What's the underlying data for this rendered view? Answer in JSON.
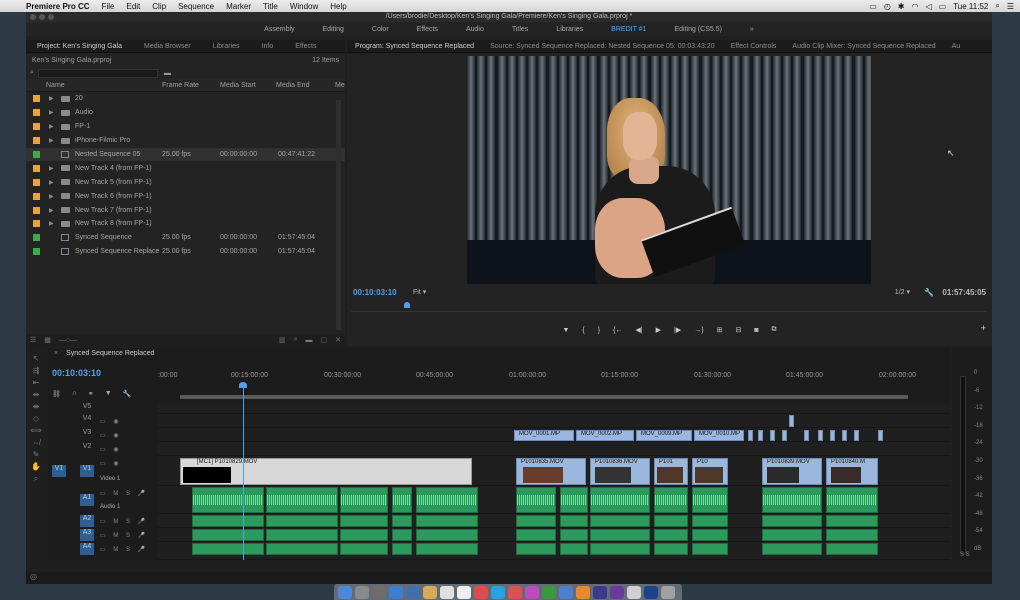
{
  "menubar": {
    "app": "Premiere Pro CC",
    "items": [
      "File",
      "Edit",
      "Clip",
      "Sequence",
      "Marker",
      "Title",
      "Window",
      "Help"
    ],
    "clock": "Tue 11:52"
  },
  "window": {
    "title": "/Users/brodie/Desktop/Ken's Singing Gala/Premiere/Ken's Singing Gala.prproj *"
  },
  "workspaces": {
    "tabs": [
      "Assembly",
      "Editing",
      "Color",
      "Effects",
      "Audio",
      "Titles",
      "Libraries"
    ],
    "active": "BREDIT #1",
    "extra": "Editing (CS5.5)"
  },
  "project": {
    "tabs": [
      "Project: Ken's Singing Gala",
      "Media Browser",
      "Libraries",
      "Info",
      "Effects"
    ],
    "file": "Ken's Singing Gala.prproj",
    "count": "12 Items",
    "headers": {
      "name": "Name",
      "frame_rate": "Frame Rate",
      "media_start": "Media Start",
      "media_end": "Media End",
      "more": "Me"
    },
    "rows": [
      {
        "name": "20",
        "color": "#e8a33d",
        "type": "folder",
        "fr": "",
        "ms": "",
        "me": ""
      },
      {
        "name": "Audio",
        "color": "#e8a33d",
        "type": "folder",
        "fr": "",
        "ms": "",
        "me": ""
      },
      {
        "name": "FP-1",
        "color": "#e8a33d",
        "type": "folder",
        "fr": "",
        "ms": "",
        "me": ""
      },
      {
        "name": "iPhone-Filmic Pro",
        "color": "#e8a33d",
        "type": "folder",
        "fr": "",
        "ms": "",
        "me": ""
      },
      {
        "name": "Nested Sequence 05",
        "color": "#3ea84a",
        "type": "seq",
        "fr": "25.00 fps",
        "ms": "00:00:00:00",
        "me": "00:47:41:22"
      },
      {
        "name": "New Track 4 (from FP-1)",
        "color": "#e8a33d",
        "type": "folder",
        "fr": "",
        "ms": "",
        "me": ""
      },
      {
        "name": "New Track 5 (from FP-1)",
        "color": "#e8a33d",
        "type": "folder",
        "fr": "",
        "ms": "",
        "me": ""
      },
      {
        "name": "New Track 6 (from FP-1)",
        "color": "#e8a33d",
        "type": "folder",
        "fr": "",
        "ms": "",
        "me": ""
      },
      {
        "name": "New Track 7 (from FP-1)",
        "color": "#e8a33d",
        "type": "folder",
        "fr": "",
        "ms": "",
        "me": ""
      },
      {
        "name": "New Track 8 (from FP-1)",
        "color": "#e8a33d",
        "type": "folder",
        "fr": "",
        "ms": "",
        "me": ""
      },
      {
        "name": "Synced Sequence",
        "color": "#3ea84a",
        "type": "seq",
        "fr": "25.00 fps",
        "ms": "00:00:00:00",
        "me": "01:57:45:04"
      },
      {
        "name": "Synced Sequence Replace",
        "color": "#3ea84a",
        "type": "seq",
        "fr": "25.00 fps",
        "ms": "00:00:00:00",
        "me": "01:57:45:04"
      }
    ]
  },
  "program": {
    "tabs": [
      "Program: Synced Sequence Replaced",
      "Source: Synced Sequence Replaced: Nested Sequence 05: 00:03:43:20",
      "Effect Controls",
      "Audio Clip Mixer: Synced Sequence Replaced",
      "Au"
    ],
    "timecode": "00:10:03:10",
    "fit": "Fit",
    "resolution": "1/2",
    "duration": "01:57:45:05"
  },
  "timeline": {
    "tab": "Synced Sequence Replaced",
    "timecode": "00:10:03:10",
    "ruler": [
      ":00:00",
      "00:15:00:00",
      "00:30:00:00",
      "00:45:00:00",
      "01:00:00:00",
      "01:15:00:00",
      "01:30:00:00",
      "01:45:00:00",
      "02:00:00:00"
    ],
    "tracks": [
      "V5",
      "V4",
      "V3",
      "V2",
      "V1",
      "A1",
      "A2",
      "A3",
      "A4"
    ],
    "v1_name": "Video 1",
    "a1_name": "Audio 1",
    "v1_src": "V1",
    "a1_src": "A1",
    "clips_v3": [
      "MOV_0001.MP",
      "MOV_0002.MP",
      "MOV_0009.MP",
      "MOV_0010.MP"
    ],
    "clips_v1": [
      "[MC1] P1010829.MOV",
      "P1010835.MOV",
      "P1010836.MOV",
      "P101",
      "P10",
      "P1010839.MOV",
      "P1010840.M"
    ]
  },
  "meter": {
    "scale": [
      "0",
      "-6",
      "-12",
      "-18",
      "-24",
      "-30",
      "-36",
      "-42",
      "-48",
      "-54",
      "dB"
    ],
    "solo": "S S"
  }
}
